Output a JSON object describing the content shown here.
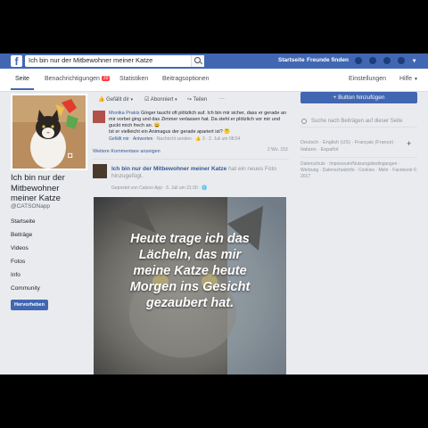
{
  "topbar": {
    "search_value": "Ich bin nur der Mitbewohner meiner Katze",
    "nav": [
      "Startseite",
      "Freunde finden"
    ]
  },
  "tabs": {
    "items": [
      "Seite",
      "Benachrichtigungen",
      "Statistiken",
      "Beitragsoptionen"
    ],
    "notif_badge": "20",
    "settings": "Einstellungen",
    "help": "Hilfe"
  },
  "page": {
    "name": "Ich bin nur der Mitbewohner meiner Katze",
    "handle": "@CATSONapp",
    "nav": [
      "Startseite",
      "Beiträge",
      "Videos",
      "Fotos",
      "Info",
      "Community"
    ],
    "promote": "Hervorheben"
  },
  "actions": {
    "liked": "Gefällt dir",
    "subscribed": "Abonniert",
    "share": "Teilen"
  },
  "comment": {
    "author": "Monika Prakis",
    "line1": "Ginger taucht oft plötzlich auf. Ich bin mir sicher, dass er gerade an mir vorbei ging und das Zimmer verlassen hat. Da steht er plötzlich vor mir und guckt mich frech an.",
    "line2": "Ist er vielleicht ein Animagus der gerade apariert ist?",
    "like": "Gefällt mir",
    "reply": "Antworten",
    "message": "Nachricht senden",
    "count": "3",
    "date": "2. Juli um 08:54",
    "age": "2 Wo.",
    "reply_count": "153"
  },
  "more_comments": "Weitere Kommentare anzeigen",
  "post": {
    "page_name": "Ich bin nur der Mitbewohner meiner Katze",
    "action": "hat ein neues Foto hinzugefügt.",
    "meta": "Gepostet von Catson App · 5. Juli um 21:30 ·",
    "image_text": [
      "Heute trage ich das",
      "Lächeln, das mir",
      "meine Katze heute",
      "Morgen ins Gesicht",
      "gezaubert hat."
    ]
  },
  "sidebar": {
    "add_button": "+ Button hinzufügen",
    "search_placeholder": "Suche nach Beiträgen auf dieser Seite",
    "langs": "Deutsch · English (US) · Français (France) · Italiano · Español",
    "footer": "Datenschutz · Impressum/Nutzungsbedingungen · Werbung · Datenschutzinfo · Cookies · Mehr · Facebook © 2017"
  },
  "colors": {
    "brand": "#4267b2",
    "link": "#365899",
    "background": "#e9ebee"
  }
}
